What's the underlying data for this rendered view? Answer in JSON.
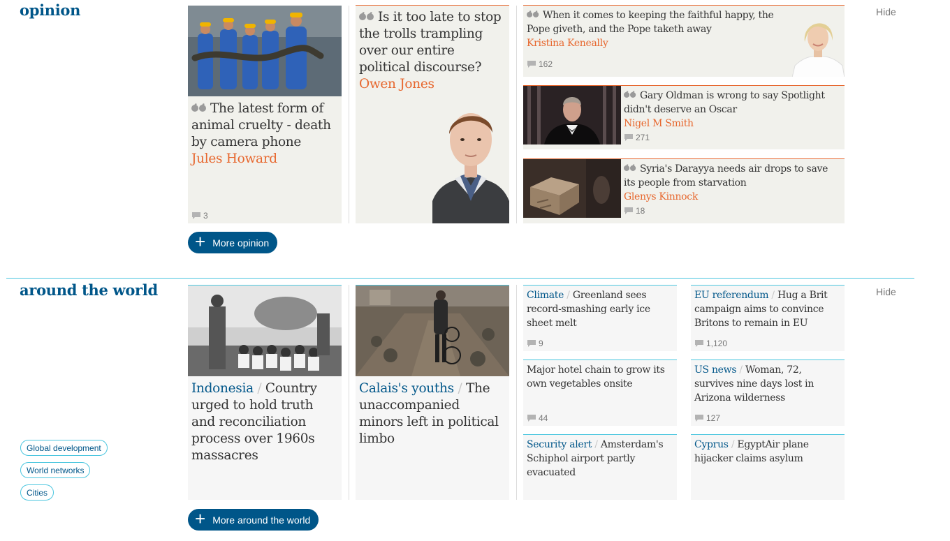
{
  "opinion": {
    "title": "opinion",
    "hide_label": "Hide",
    "more_label": "More opinion",
    "cards": [
      {
        "headline": "The latest form of animal cruelty - death by camera phone",
        "byline": "Jules Howard",
        "comments": "3"
      },
      {
        "headline": "Is it too late to stop the trolls trampling over our entire political discourse?",
        "byline": "Owen Jones"
      },
      {
        "headline": "When it comes to keeping the faithful happy, the Pope giveth, and the Pope taketh away",
        "byline": "Kristina Keneally",
        "comments": "162"
      },
      {
        "headline": "Gary Oldman is wrong to say Spotlight didn't deserve an Oscar",
        "byline": "Nigel M Smith",
        "comments": "271"
      },
      {
        "headline": "Syria's Darayya needs air drops to save its people from starvation",
        "byline": "Glenys Kinnock",
        "comments": "18"
      }
    ]
  },
  "world": {
    "title": "around the world",
    "hide_label": "Hide",
    "more_label": "More around the world",
    "tags": [
      "Global development",
      "World networks",
      "Cities"
    ],
    "cards": [
      {
        "kicker": "Indonesia",
        "headline": "Country urged to hold truth and reconciliation process over 1960s massacres"
      },
      {
        "kicker": "Calais's youths",
        "headline": "The unaccompanied minors left in political limbo"
      },
      {
        "kicker": "Climate",
        "headline": "Greenland sees record-smashing early ice sheet melt",
        "comments": "9"
      },
      {
        "kicker": "",
        "headline": "Major hotel chain to grow its own vegetables onsite",
        "comments": "44"
      },
      {
        "kicker": "Security alert",
        "headline": "Amsterdam's Schiphol airport partly evacuated"
      },
      {
        "kicker": "EU referendum",
        "headline": "Hug a Brit campaign aims to convince Britons to remain in EU",
        "comments": "1,120"
      },
      {
        "kicker": "US news",
        "headline": "Woman, 72, survives nine days lost in Arizona wilderness",
        "comments": "127"
      },
      {
        "kicker": "Cyprus",
        "headline": "EgyptAir plane hijacker claims asylum"
      }
    ]
  },
  "colors": {
    "brand_blue": "#005689",
    "opinion_orange": "#e7672e",
    "news_cyan": "#4bc6df"
  },
  "icons": [
    "quote-icon",
    "comment-icon",
    "plus-icon"
  ]
}
